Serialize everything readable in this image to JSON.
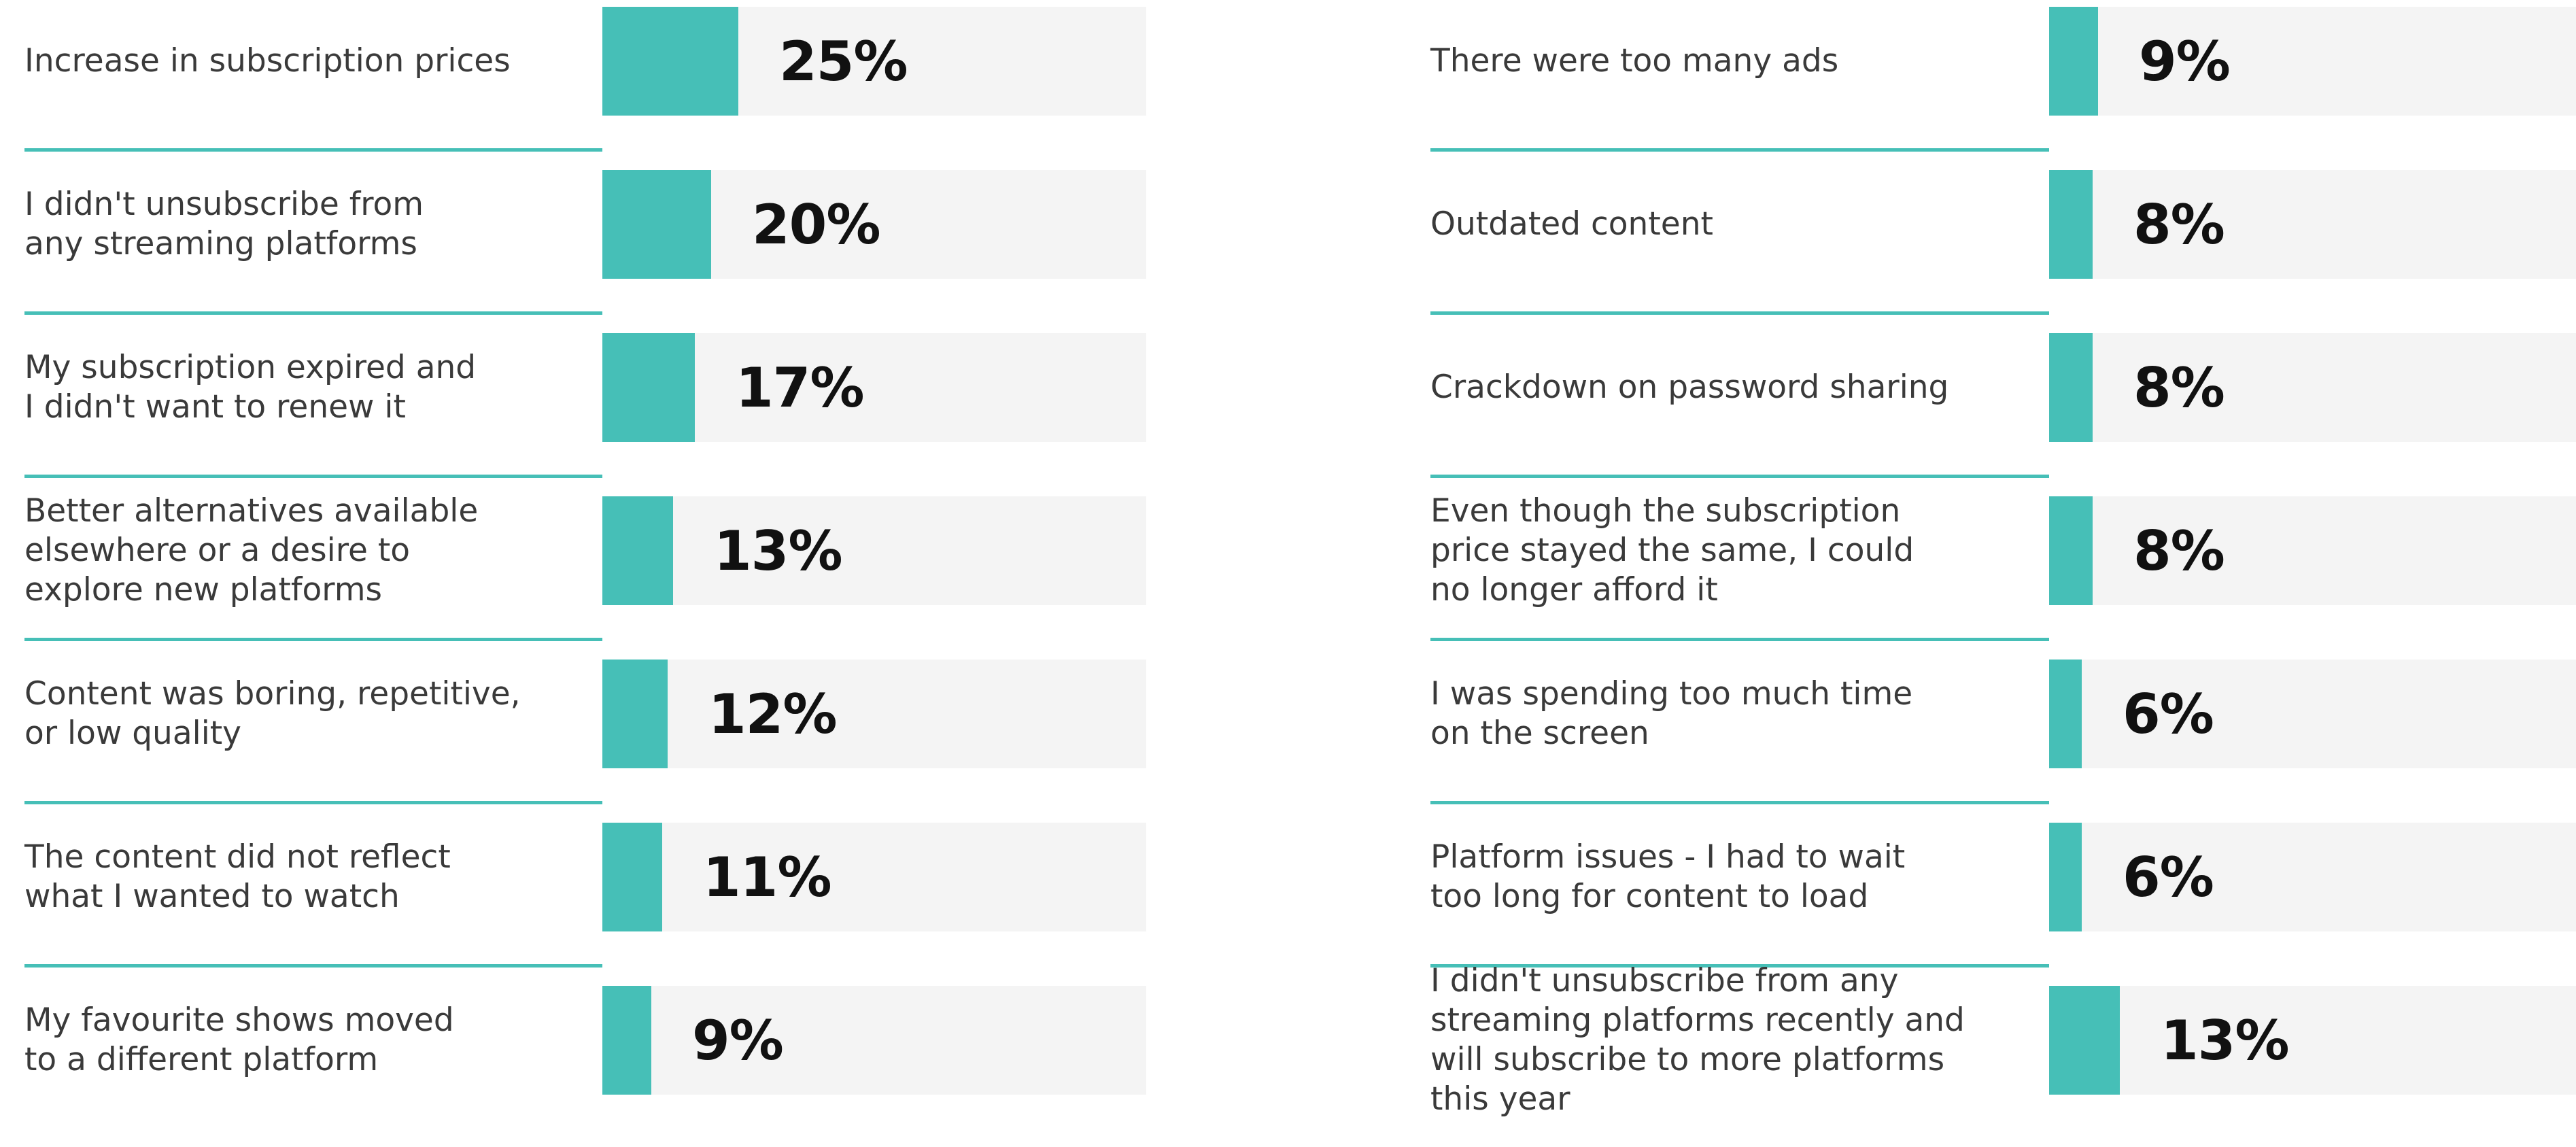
{
  "chart_data": [
    {
      "type": "bar",
      "orientation": "horizontal",
      "unit": "%",
      "categories": [
        "Increase in subscription prices",
        "I didn't unsubscribe from\nany streaming platforms",
        "My subscription expired and\nI didn't want to renew it",
        "Better alternatives available\nelsewhere or a desire to\nexplore new platforms",
        "Content was boring, repetitive,\nor low quality",
        "The content did not reflect\nwhat I wanted to watch",
        "My favourite shows moved\nto a different platform"
      ],
      "values": [
        25,
        20,
        17,
        13,
        12,
        11,
        9
      ],
      "value_labels": [
        "25%",
        "20%",
        "17%",
        "13%",
        "12%",
        "11%",
        "9%"
      ],
      "bar_color": "#46bfb7",
      "track_color": "#f4f4f4"
    },
    {
      "type": "bar",
      "orientation": "horizontal",
      "unit": "%",
      "categories": [
        "There were too many ads",
        "Outdated content",
        "Crackdown on password sharing",
        "Even though the subscription\nprice stayed the same, I could\nno longer afford it",
        "I was spending too much time\non the screen",
        "Platform issues - I had to wait\ntoo long for content to load",
        "I didn't unsubscribe from any\nstreaming platforms recently and\nwill subscribe to more platforms\nthis year"
      ],
      "values": [
        9,
        8,
        8,
        8,
        6,
        6,
        13
      ],
      "value_labels": [
        "9%",
        "8%",
        "8%",
        "8%",
        "6%",
        "6%",
        "13%"
      ],
      "bar_color": "#46bfb7",
      "track_color": "#f4f4f4"
    }
  ]
}
